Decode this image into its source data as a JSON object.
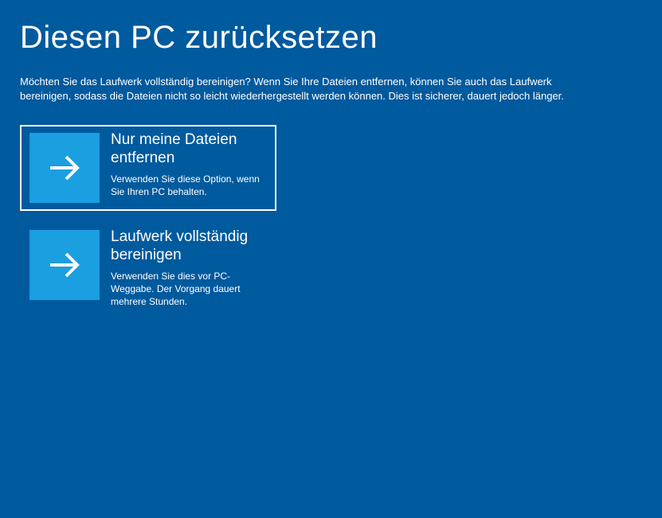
{
  "page": {
    "title": "Diesen PC zurücksetzen",
    "description": "Möchten Sie das Laufwerk vollständig bereinigen? Wenn Sie Ihre Dateien entfernen, können Sie auch das Laufwerk bereinigen, sodass die Dateien nicht so leicht wiederhergestellt werden können. Dies ist sicherer, dauert jedoch länger."
  },
  "options": [
    {
      "title": "Nur meine Dateien entfernen",
      "subtitle": "Verwenden Sie diese Option, wenn Sie Ihren PC behalten.",
      "selected": true
    },
    {
      "title": "Laufwerk vollständig bereinigen",
      "subtitle": "Verwenden Sie dies vor PC-Weggabe. Der Vorgang dauert mehrere Stunden.",
      "selected": false
    }
  ]
}
